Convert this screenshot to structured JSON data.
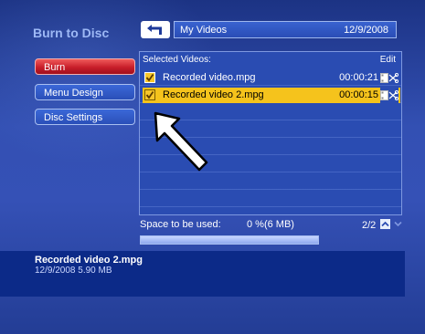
{
  "page": {
    "title": "Burn to Disc"
  },
  "nav": {
    "burn": "Burn",
    "menu_design": "Menu Design",
    "disc_settings": "Disc Settings"
  },
  "header": {
    "path": "My Videos",
    "date": "12/9/2008"
  },
  "list": {
    "header_label": "Selected Videos:",
    "edit_label": "Edit",
    "rows": [
      {
        "name": "Recorded video.mpg",
        "duration": "00:00:21",
        "checked": true,
        "selected": false
      },
      {
        "name": "Recorded video 2.mpg",
        "duration": "00:00:15",
        "checked": true,
        "selected": true
      }
    ]
  },
  "footer": {
    "space_label": "Space to be used:",
    "space_value": "0 %(6 MB)",
    "space_percent": 0,
    "page_count": "2/2"
  },
  "info": {
    "file_name": "Recorded video 2.mpg",
    "file_meta": "12/9/2008  5.90 MB"
  },
  "colors": {
    "accent_red": "#c81e2a",
    "highlight_yellow": "#f5c31c",
    "background_blue": "#3350b3"
  },
  "icons": {
    "up": "up-arrow-icon",
    "checkbox": "checkmark-icon",
    "edit": "film-scissors-icon",
    "page_up": "chevron-up-icon",
    "page_down": "chevron-down-icon"
  }
}
